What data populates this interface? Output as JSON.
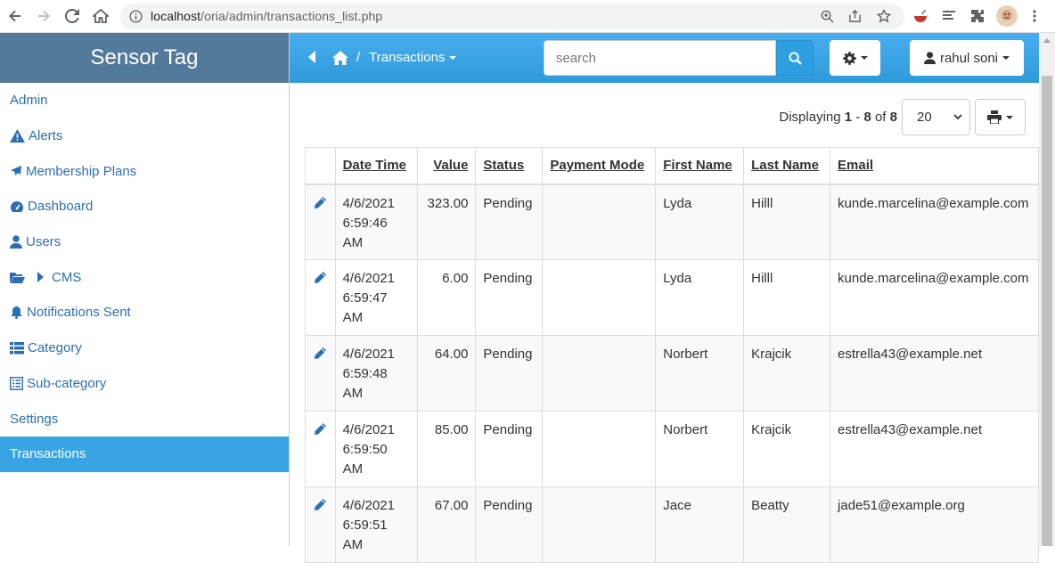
{
  "browser": {
    "url_host": "localhost",
    "url_path": "/oria/admin/transactions_list.php"
  },
  "sidebar": {
    "brand": "Sensor Tag",
    "items": [
      {
        "label": "Admin",
        "icon": "none"
      },
      {
        "label": "Alerts",
        "icon": "warning-icon"
      },
      {
        "label": "Membership Plans",
        "icon": "plane-icon"
      },
      {
        "label": "Dashboard",
        "icon": "dashboard-icon"
      },
      {
        "label": "Users",
        "icon": "user-icon"
      },
      {
        "label": "CMS",
        "icon": "folder-icon"
      },
      {
        "label": "Notifications Sent",
        "icon": "bell-icon"
      },
      {
        "label": "Category",
        "icon": "list-icon"
      },
      {
        "label": "Sub-category",
        "icon": "list-alt-icon"
      },
      {
        "label": "Settings",
        "icon": "none"
      },
      {
        "label": "Transactions",
        "icon": "none",
        "active": true
      }
    ]
  },
  "topbar": {
    "breadcrumb_sep": "/",
    "breadcrumb_current": "Transactions",
    "search_placeholder": "search",
    "user_name": "rahul soni"
  },
  "pager": {
    "prefix": "Displaying",
    "from": "1",
    "dash": "-",
    "to": "8",
    "of": "of",
    "total": "8",
    "per_page": "20"
  },
  "table": {
    "headers": [
      "Date Time",
      "Value",
      "Status",
      "Payment Mode",
      "First Name",
      "Last Name",
      "Email"
    ],
    "rows": [
      {
        "date": "4/6/2021",
        "time": "6:59:46",
        "ampm": "AM",
        "value": "323.00",
        "status": "Pending",
        "payment": "",
        "first": "Lyda",
        "last": "Hilll",
        "email": "kunde.marcelina@example.com"
      },
      {
        "date": "4/6/2021",
        "time": "6:59:47",
        "ampm": "AM",
        "value": "6.00",
        "status": "Pending",
        "payment": "",
        "first": "Lyda",
        "last": "Hilll",
        "email": "kunde.marcelina@example.com"
      },
      {
        "date": "4/6/2021",
        "time": "6:59:48",
        "ampm": "AM",
        "value": "64.00",
        "status": "Pending",
        "payment": "",
        "first": "Norbert",
        "last": "Krajcik",
        "email": "estrella43@example.net"
      },
      {
        "date": "4/6/2021",
        "time": "6:59:50",
        "ampm": "AM",
        "value": "85.00",
        "status": "Pending",
        "payment": "",
        "first": "Norbert",
        "last": "Krajcik",
        "email": "estrella43@example.net"
      },
      {
        "date": "4/6/2021",
        "time": "6:59:51",
        "ampm": "AM",
        "value": "67.00",
        "status": "Pending",
        "payment": "",
        "first": "Jace",
        "last": "Beatty",
        "email": "jade51@example.org"
      }
    ]
  },
  "colors": {
    "brand_bg": "#547a9b",
    "topbar_bg": "#3aa3e3",
    "active_item": "#3aa3e3",
    "link": "#2a6fb5"
  }
}
